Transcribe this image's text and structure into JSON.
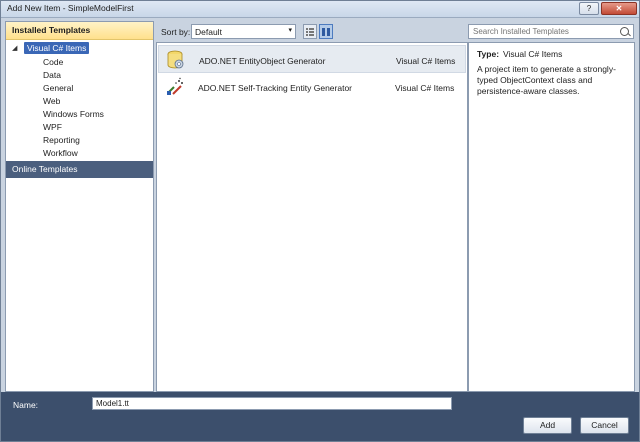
{
  "window": {
    "title": "Add New Item - SimpleModelFirst",
    "help_label": "?",
    "close_label": "✕"
  },
  "left": {
    "installed_header": "Installed Templates",
    "root": {
      "label": "Visual C# Items",
      "arrow": "◢"
    },
    "items": [
      "Code",
      "Data",
      "General",
      "Web",
      "Windows Forms",
      "WPF",
      "Reporting",
      "Workflow"
    ],
    "online_header": "Online Templates"
  },
  "toolbar": {
    "sort_label": "Sort by:",
    "sort_value": "Default",
    "sort_arrow": "▾",
    "view_list_icon": "list-view-icon",
    "view_small_icon": "small-icon-view-icon"
  },
  "search": {
    "placeholder": "Search Installed Templates",
    "icon": "search-icon"
  },
  "templates": [
    {
      "name": "ADO.NET EntityObject Generator",
      "type": "Visual C# Items",
      "icon": "database-gear-icon",
      "selected": true
    },
    {
      "name": "ADO.NET Self-Tracking Entity Generator",
      "type": "Visual C# Items",
      "icon": "tracking-generator-icon",
      "selected": false
    }
  ],
  "details": {
    "type_label": "Type:",
    "type_value": "Visual C# Items",
    "description": "A project item to generate a strongly-typed ObjectContext class and persistence-aware classes."
  },
  "bottom": {
    "name_label": "Name:",
    "name_value": "Model1.tt",
    "add_label": "Add",
    "cancel_label": "Cancel"
  }
}
